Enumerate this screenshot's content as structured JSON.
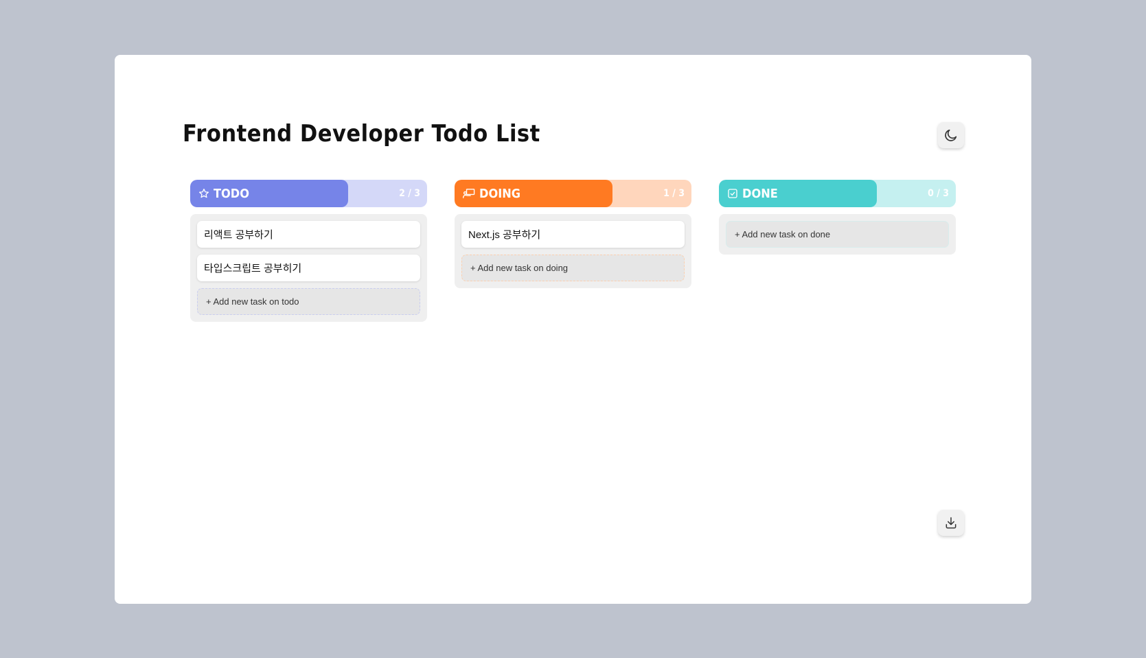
{
  "page": {
    "title": "Frontend Developer Todo List"
  },
  "controls": {
    "theme_icon": "moon-icon",
    "download_icon": "download-icon"
  },
  "columns": [
    {
      "key": "todo",
      "label": "TODO",
      "count": "2 / 3",
      "progress": 0.6667,
      "icon": "star-icon",
      "color": "#7684e8",
      "track_color": "#d4d8f8",
      "tasks": [
        "리액트 공부하기",
        "타입스크립트 공부히기"
      ],
      "add_label": "+ Add new task on todo"
    },
    {
      "key": "doing",
      "label": "DOING",
      "count": "1 / 3",
      "progress": 0.6667,
      "icon": "presenter-icon",
      "color": "#ff7a22",
      "track_color": "#ffd6bc",
      "tasks": [
        "Next.js 공부하기"
      ],
      "add_label": "+ Add new task on doing"
    },
    {
      "key": "done",
      "label": "DONE",
      "count": "0 / 3",
      "progress": 0.6667,
      "icon": "checkbox-icon",
      "color": "#4acfcf",
      "track_color": "#c5f0f0",
      "tasks": [],
      "add_label": "+ Add new task on done"
    }
  ]
}
